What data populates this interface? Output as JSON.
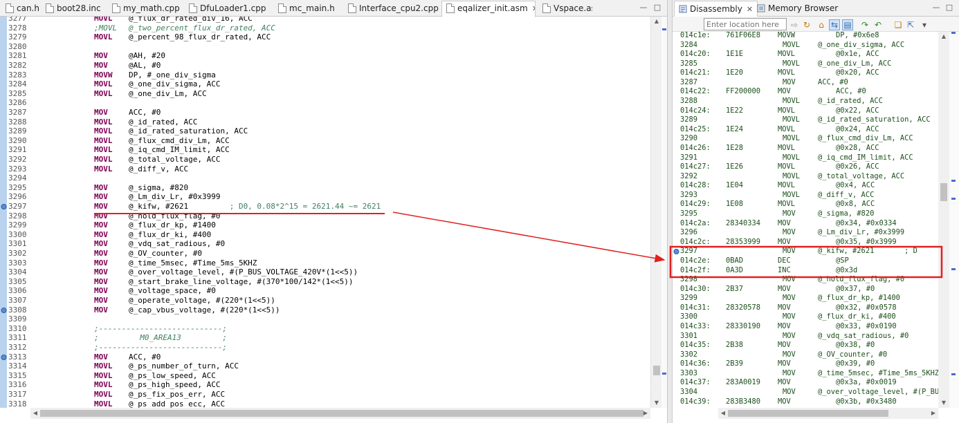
{
  "colors": {
    "annotation_red": "#e02020",
    "gutter_blue": "#b9d3ee",
    "keyword": "#7f0055",
    "comment": "#3f7f5f",
    "disasm_text": "#1c4f1c",
    "ruler_marker": "#4a6bd0"
  },
  "editor": {
    "tabs": [
      {
        "label": "can.h",
        "icon": "header-file-icon",
        "active": false
      },
      {
        "label": "boot28.inc",
        "icon": "file-icon",
        "active": false
      },
      {
        "label": "my_math.cpp",
        "icon": "source-file-icon",
        "active": false
      },
      {
        "label": "DfuLoader1.cpp",
        "icon": "source-file-icon",
        "active": false
      },
      {
        "label": "mc_main.h",
        "icon": "header-file-icon",
        "active": false
      },
      {
        "label": "Interface_cpu2.cpp",
        "icon": "source-file-icon",
        "active": false
      },
      {
        "label": "eqalizer_init.asm",
        "icon": "asm-file-icon",
        "active": true,
        "close": "✕"
      },
      {
        "label": "Vspace.asm",
        "icon": "asm-file-icon",
        "active": false
      }
    ],
    "lines": [
      {
        "num": "3277",
        "op": "MOVL",
        "arg": "@_flux_dr_rated_div_16, ACC"
      },
      {
        "num": "3278",
        "op": ";MOVL",
        "arg": "@_two_percent_flux_dr_rated, ACC",
        "comment": true
      },
      {
        "num": "3279",
        "op": "MOVL",
        "arg": "@_percent_98_flux_dr_rated, ACC"
      },
      {
        "num": "3280",
        "op": "",
        "arg": ""
      },
      {
        "num": "3281",
        "op": "MOV",
        "arg": "@AH, #20"
      },
      {
        "num": "3282",
        "op": "MOV",
        "arg": "@AL, #0"
      },
      {
        "num": "3283",
        "op": "MOVW",
        "arg": "DP, #_one_div_sigma"
      },
      {
        "num": "3284",
        "op": "MOVL",
        "arg": "@_one_div_sigma, ACC"
      },
      {
        "num": "3285",
        "op": "MOVL",
        "arg": "@_one_div_Lm, ACC"
      },
      {
        "num": "3286",
        "op": "",
        "arg": ""
      },
      {
        "num": "3287",
        "op": "MOV",
        "arg": "ACC, #0"
      },
      {
        "num": "3288",
        "op": "MOVL",
        "arg": "@_id_rated, ACC"
      },
      {
        "num": "3289",
        "op": "MOVL",
        "arg": "@_id_rated_saturation, ACC"
      },
      {
        "num": "3290",
        "op": "MOVL",
        "arg": "@_flux_cmd_div_Lm, ACC"
      },
      {
        "num": "3291",
        "op": "MOVL",
        "arg": "@_iq_cmd_IM_limit, ACC"
      },
      {
        "num": "3292",
        "op": "MOVL",
        "arg": "@_total_voltage, ACC"
      },
      {
        "num": "3293",
        "op": "MOVL",
        "arg": "@_diff_v, ACC"
      },
      {
        "num": "3294",
        "op": "",
        "arg": ""
      },
      {
        "num": "3295",
        "op": "MOV",
        "arg": "@_sigma, #820"
      },
      {
        "num": "3296",
        "op": "MOV",
        "arg": "@_Lm_div_Lr, #0x3999"
      },
      {
        "num": "3297",
        "op": "MOV",
        "arg": "@_kifw, #2621",
        "trail": "         ; D0, 0.08*2^15 = 2621.44 ~= 2621",
        "marker": true
      },
      {
        "num": "3298",
        "op": "MOV",
        "arg": "@_hold_flux_flag, #0"
      },
      {
        "num": "3299",
        "op": "MOV",
        "arg": "@_flux_dr_kp, #1400"
      },
      {
        "num": "3300",
        "op": "MOV",
        "arg": "@_flux_dr_ki, #400"
      },
      {
        "num": "3301",
        "op": "MOV",
        "arg": "@_vdq_sat_radious, #0"
      },
      {
        "num": "3302",
        "op": "MOV",
        "arg": "@_OV_counter, #0"
      },
      {
        "num": "3303",
        "op": "MOV",
        "arg": "@_time_5msec, #Time_5ms_5KHZ"
      },
      {
        "num": "3304",
        "op": "MOV",
        "arg": "@_over_voltage_level, #(P_BUS_VOLTAGE_420V*(1<<5))"
      },
      {
        "num": "3305",
        "op": "MOV",
        "arg": "@_start_brake_line_voltage, #(370*100/142*(1<<5))"
      },
      {
        "num": "3306",
        "op": "MOV",
        "arg": "@_voltage_space, #0"
      },
      {
        "num": "3307",
        "op": "MOV",
        "arg": "@_operate_voltage, #(220*(1<<5))"
      },
      {
        "num": "3308",
        "op": "MOV",
        "arg": "@_cap_vbus_voltage, #(220*(1<<5))",
        "marker": true
      },
      {
        "num": "3309",
        "op": "",
        "arg": ""
      },
      {
        "num": "3310",
        "op": ";---------------------------;",
        "arg": "",
        "comment": true
      },
      {
        "num": "3311",
        "op": ";         M0_AREA13         ;",
        "arg": "",
        "comment": true
      },
      {
        "num": "3312",
        "op": ";---------------------------;",
        "arg": "",
        "comment": true
      },
      {
        "num": "3313",
        "op": "MOV",
        "arg": "ACC, #0",
        "marker": true
      },
      {
        "num": "3314",
        "op": "MOVL",
        "arg": "@_ps_number_of_turn, ACC"
      },
      {
        "num": "3315",
        "op": "MOVL",
        "arg": "@_ps_low_speed, ACC"
      },
      {
        "num": "3316",
        "op": "MOVL",
        "arg": "@_ps_high_speed, ACC"
      },
      {
        "num": "3317",
        "op": "MOVL",
        "arg": "@_ps_fix_pos_err, ACC"
      },
      {
        "num": "3318",
        "op": "MOVL",
        "arg": "@_ps_add_pos_ecc, ACC"
      }
    ]
  },
  "disasm": {
    "tabs": [
      {
        "label": "Disassembly",
        "icon": "disassembly-icon",
        "active": true,
        "close": "✕"
      },
      {
        "label": "Memory Browser",
        "icon": "memory-browser-icon",
        "active": false
      }
    ],
    "location_placeholder": "Enter location here",
    "lines": [
      {
        "type": "asm",
        "addr": "014c1e:",
        "opc": "761F06E8",
        "mnem": "MOVW",
        "oper": "DP, #0x6e8"
      },
      {
        "type": "src",
        "num": "3284",
        "mnem": "MOVL",
        "oper": "@_one_div_sigma, ACC"
      },
      {
        "type": "asm",
        "addr": "014c20:",
        "opc": "1E1E",
        "mnem": "MOVL",
        "oper": "@0x1e, ACC"
      },
      {
        "type": "src",
        "num": "3285",
        "mnem": "MOVL",
        "oper": "@_one_div_Lm, ACC"
      },
      {
        "type": "asm",
        "addr": "014c21:",
        "opc": "1E20",
        "mnem": "MOVL",
        "oper": "@0x20, ACC"
      },
      {
        "type": "src",
        "num": "3287",
        "mnem": "MOV",
        "oper": "ACC, #0"
      },
      {
        "type": "asm",
        "addr": "014c22:",
        "opc": "FF200000",
        "mnem": "MOV",
        "oper": "ACC, #0"
      },
      {
        "type": "src",
        "num": "3288",
        "mnem": "MOVL",
        "oper": "@_id_rated, ACC"
      },
      {
        "type": "asm",
        "addr": "014c24:",
        "opc": "1E22",
        "mnem": "MOVL",
        "oper": "@0x22, ACC"
      },
      {
        "type": "src",
        "num": "3289",
        "mnem": "MOVL",
        "oper": "@_id_rated_saturation, ACC"
      },
      {
        "type": "asm",
        "addr": "014c25:",
        "opc": "1E24",
        "mnem": "MOVL",
        "oper": "@0x24, ACC"
      },
      {
        "type": "src",
        "num": "3290",
        "mnem": "MOVL",
        "oper": "@_flux_cmd_div_Lm, ACC"
      },
      {
        "type": "asm",
        "addr": "014c26:",
        "opc": "1E28",
        "mnem": "MOVL",
        "oper": "@0x28, ACC"
      },
      {
        "type": "src",
        "num": "3291",
        "mnem": "MOVL",
        "oper": "@_iq_cmd_IM_limit, ACC"
      },
      {
        "type": "asm",
        "addr": "014c27:",
        "opc": "1E26",
        "mnem": "MOVL",
        "oper": "@0x26, ACC"
      },
      {
        "type": "src",
        "num": "3292",
        "mnem": "MOVL",
        "oper": "@_total_voltage, ACC"
      },
      {
        "type": "asm",
        "addr": "014c28:",
        "opc": "1E04",
        "mnem": "MOVL",
        "oper": "@0x4, ACC"
      },
      {
        "type": "src",
        "num": "3293",
        "mnem": "MOVL",
        "oper": "@_diff_v, ACC"
      },
      {
        "type": "asm",
        "addr": "014c29:",
        "opc": "1E08",
        "mnem": "MOVL",
        "oper": "@0x8, ACC"
      },
      {
        "type": "src",
        "num": "3295",
        "mnem": "MOV",
        "oper": "@_sigma, #820"
      },
      {
        "type": "asm",
        "addr": "014c2a:",
        "opc": "28340334",
        "mnem": "MOV",
        "oper": "@0x34, #0x0334"
      },
      {
        "type": "src",
        "num": "3296",
        "mnem": "MOV",
        "oper": "@_Lm_div_Lr, #0x3999"
      },
      {
        "type": "asm",
        "addr": "014c2c:",
        "opc": "28353999",
        "mnem": "MOV",
        "oper": "@0x35, #0x3999"
      },
      {
        "type": "src",
        "num": "3297",
        "mnem": "MOV",
        "oper": "@_kifw, #2621",
        "trail": "       ; D",
        "marker": true
      },
      {
        "type": "asm",
        "addr": "014c2e:",
        "opc": "0BAD",
        "mnem": "DEC",
        "oper": "@SP"
      },
      {
        "type": "asm",
        "addr": "014c2f:",
        "opc": "0A3D",
        "mnem": "INC",
        "oper": "@0x3d"
      },
      {
        "type": "src",
        "num": "3298",
        "mnem": "MOV",
        "oper": "@_hold_flux_flag, #0"
      },
      {
        "type": "asm",
        "addr": "014c30:",
        "opc": "2B37",
        "mnem": "MOV",
        "oper": "@0x37, #0"
      },
      {
        "type": "src",
        "num": "3299",
        "mnem": "MOV",
        "oper": "@_flux_dr_kp, #1400"
      },
      {
        "type": "asm",
        "addr": "014c31:",
        "opc": "28320578",
        "mnem": "MOV",
        "oper": "@0x32, #0x0578"
      },
      {
        "type": "src",
        "num": "3300",
        "mnem": "MOV",
        "oper": "@_flux_dr_ki, #400"
      },
      {
        "type": "asm",
        "addr": "014c33:",
        "opc": "28330190",
        "mnem": "MOV",
        "oper": "@0x33, #0x0190"
      },
      {
        "type": "src",
        "num": "3301",
        "mnem": "MOV",
        "oper": "@_vdq_sat_radious, #0"
      },
      {
        "type": "asm",
        "addr": "014c35:",
        "opc": "2B38",
        "mnem": "MOV",
        "oper": "@0x38, #0"
      },
      {
        "type": "src",
        "num": "3302",
        "mnem": "MOV",
        "oper": "@_OV_counter, #0"
      },
      {
        "type": "asm",
        "addr": "014c36:",
        "opc": "2B39",
        "mnem": "MOV",
        "oper": "@0x39, #0"
      },
      {
        "type": "src",
        "num": "3303",
        "mnem": "MOV",
        "oper": "@_time_5msec, #Time_5ms_5KHZ"
      },
      {
        "type": "asm",
        "addr": "014c37:",
        "opc": "283A0019",
        "mnem": "MOV",
        "oper": "@0x3a, #0x0019"
      },
      {
        "type": "src",
        "num": "3304",
        "mnem": "MOV",
        "oper": "@_over_voltage_level, #(P_BU"
      },
      {
        "type": "asm",
        "addr": "014c39:",
        "opc": "283B3480",
        "mnem": "MOV",
        "oper": "@0x3b, #0x3480"
      }
    ]
  }
}
